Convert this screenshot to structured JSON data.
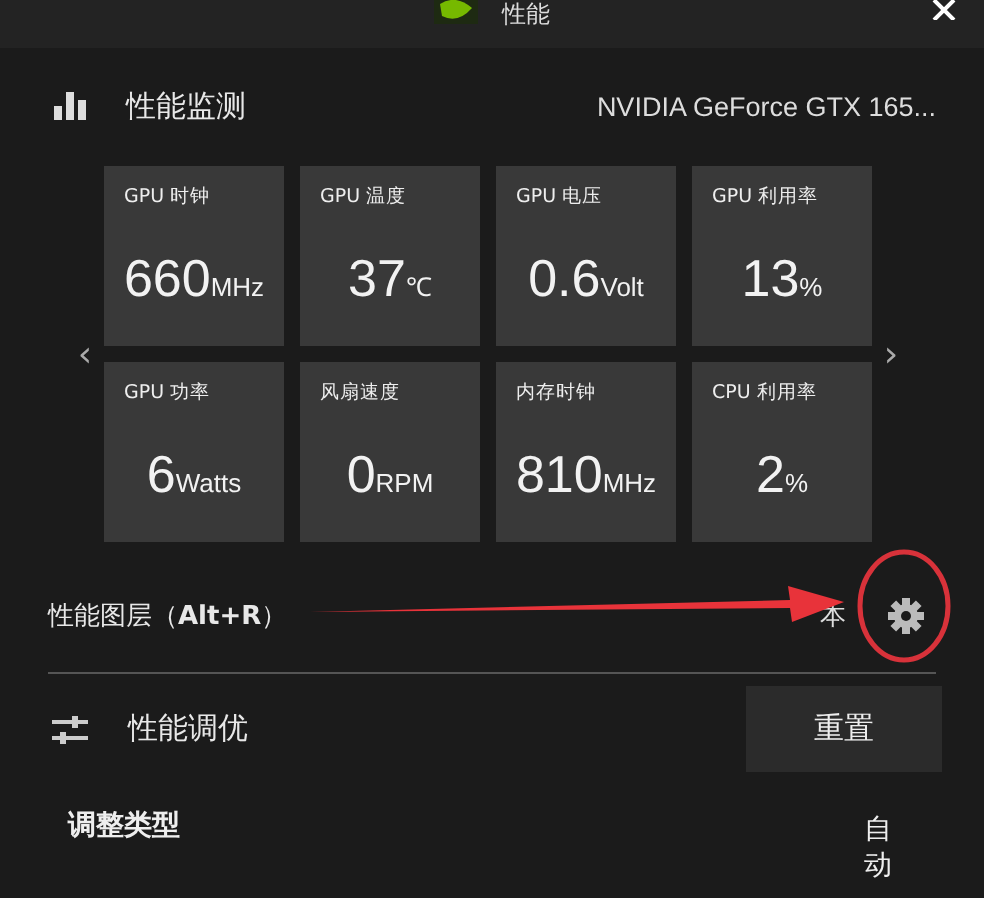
{
  "window": {
    "title": "性能"
  },
  "monitor": {
    "title": "性能监测",
    "gpu_name": "NVIDIA GeForce GTX 165...",
    "tiles": [
      {
        "label": "GPU 时钟",
        "value": "660",
        "unit": "MHz"
      },
      {
        "label": "GPU 温度",
        "value": "37",
        "unit": "℃"
      },
      {
        "label": "GPU 电压",
        "value": "0.6",
        "unit": "Volt"
      },
      {
        "label": "GPU 利用率",
        "value": "13",
        "unit": "%"
      },
      {
        "label": "GPU 功率",
        "value": "6",
        "unit": "Watts"
      },
      {
        "label": "风扇速度",
        "value": "0",
        "unit": "RPM"
      },
      {
        "label": "内存时钟",
        "value": "810",
        "unit": "MHz"
      },
      {
        "label": "CPU 利用率",
        "value": "2",
        "unit": "%"
      }
    ],
    "prev": "‹",
    "next": "›"
  },
  "overlay": {
    "label": "性能图层（**Alt+R**）",
    "value": "本"
  },
  "tuning": {
    "title": "性能调优",
    "reset_button": "重置",
    "type_label": "调整类型",
    "type_value": "自动"
  }
}
